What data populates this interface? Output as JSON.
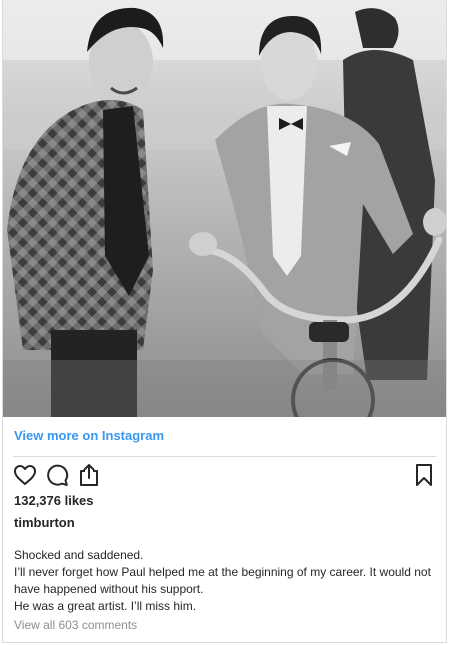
{
  "post": {
    "image_alt": "Black and white photo of two men, one in a checkered jacket and one in a suit riding a bicycle",
    "view_more_label": "View more on Instagram",
    "likes_label": "132,376 likes",
    "username": "timburton",
    "caption_lines": [
      "Shocked and saddened.",
      "I’ll never forget how Paul helped me at the beginning of my career. It would not have happened without his support.",
      "He was a great artist. I’ll miss him."
    ],
    "comments_label": "View all 603 comments"
  },
  "icons": {
    "like": "heart-icon",
    "comment": "comment-icon",
    "share": "share-icon",
    "save": "bookmark-icon"
  },
  "colors": {
    "link": "#3897f0",
    "text": "#262626",
    "muted": "#8e8e8e",
    "border": "#dbdbdb"
  }
}
